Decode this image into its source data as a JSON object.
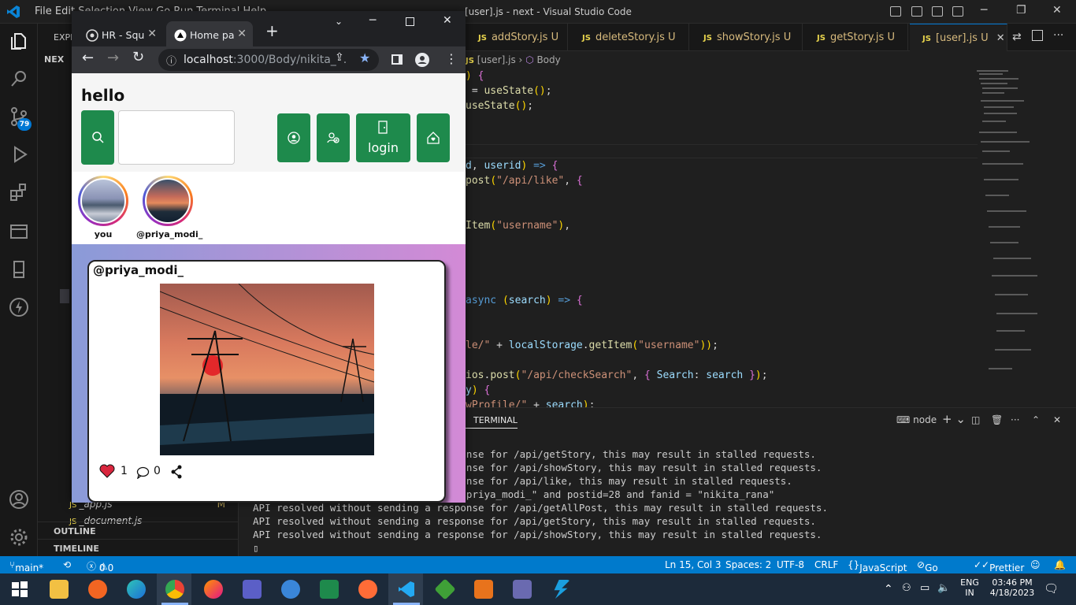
{
  "vscode": {
    "menu": "File   Edit   Selection   View   Go   Run   Terminal   Help",
    "window_title": "[user].js - next - Visual Studio Code",
    "sidebar": {
      "explorer_label": "EXPL",
      "folder_label": "NEX",
      "files": [
        {
          "name": "_app.js",
          "status": "M"
        },
        {
          "name": "_document.js",
          "status": ""
        }
      ],
      "outline": "OUTLINE",
      "timeline": "TIMELINE"
    },
    "scm_badge": "79",
    "tabs": [
      {
        "label": "addStory.js",
        "status": "U"
      },
      {
        "label": "deleteStory.js",
        "status": "U"
      },
      {
        "label": "showStory.js",
        "status": "U"
      },
      {
        "label": "getStory.js",
        "status": "U"
      },
      {
        "label": "[user].js",
        "status": "U"
      }
    ],
    "breadcrumb": {
      "file": "[user].js",
      "symbol": "Body"
    },
    "terminal": {
      "tab": "TERMINAL",
      "shell": "node",
      "lines": [
        "API resolved without sending a response for /api/getStory, this may result in stalled requests.",
        "API resolved without sending a response for /api/showStory, this may result in stalled requests.",
        "API resolved without sending a response for /api/like, this may result in stalled requests.",
        "select * from likes where userid = \"priya_modi_\" and postid=28 and fanid = \"nikita_rana\"",
        "API resolved without sending a response for /api/getAllPost, this may result in stalled requests.",
        "API resolved without sending a response for /api/getStory, this may result in stalled requests.",
        "API resolved without sending a response for /api/showStory, this may result in stalled requests."
      ]
    },
    "status": {
      "branch": "main*",
      "problems": "0",
      "warnings": "0",
      "position": "Ln 15, Col 3",
      "spaces": "Spaces: 2",
      "encoding": "UTF-8",
      "eol": "CRLF",
      "language": "JavaScript",
      "golive": "Go Live",
      "prettier": "Prettier"
    }
  },
  "chrome": {
    "tabs": [
      {
        "label": "HR - Squ"
      },
      {
        "label": "Home pa"
      }
    ],
    "url_host": "localhost",
    "url_rest": ":3000/Body/nikita_..."
  },
  "app": {
    "greeting": "hello",
    "search_placeholder": "",
    "login_label": "login",
    "stories": [
      {
        "label": "you"
      },
      {
        "label": "@priya_modi_"
      }
    ],
    "post": {
      "author": "@priya_modi_",
      "likes": "1",
      "comments": "0"
    }
  },
  "taskbar": {
    "lang_top": "ENG",
    "lang_bottom": "IN",
    "time": "03:46 PM",
    "date": "4/18/2023"
  },
  "colors": {
    "vscode_accent": "#007acc",
    "app_green": "#1e8a4c",
    "like_red": "#d9263e"
  }
}
